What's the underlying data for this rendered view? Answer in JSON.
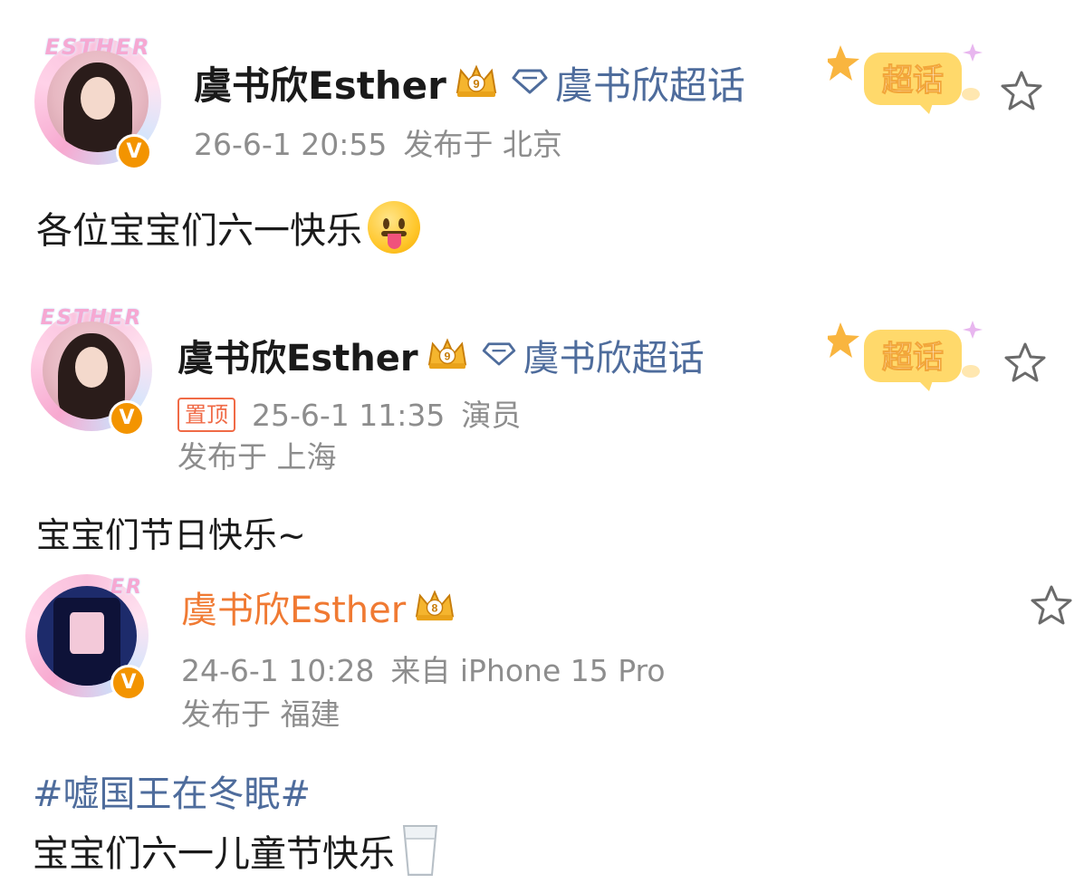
{
  "posts": [
    {
      "author": "虞书欣Esther",
      "crown_level": "9",
      "supertopic": "虞书欣超话",
      "chaohua_badge": "超话",
      "timestamp": "26-6-1 20:55",
      "location_label": "发布于 北京",
      "text": "各位宝宝们六一快乐",
      "emoji": "tongue-out-emoji",
      "avatar_ring_text": "ESTHER"
    },
    {
      "author": "虞书欣Esther",
      "crown_level": "9",
      "supertopic": "虞书欣超话",
      "chaohua_badge": "超话",
      "pinned_label": "置顶",
      "timestamp": "25-6-1 11:35",
      "role": "演员",
      "location_label": "发布于 上海",
      "text": "宝宝们节日快乐~",
      "avatar_ring_text": "ESTHER"
    },
    {
      "author": "虞书欣Esther",
      "crown_level": "8",
      "timestamp": "24-6-1 10:28",
      "source": "来自 iPhone 15 Pro",
      "location_label": "发布于 福建",
      "hashtag": "#嘘国王在冬眠#",
      "text": "宝宝们六一儿童节快乐",
      "emoji": "milk-glass-emoji",
      "avatar_ring_text": "ER"
    }
  ],
  "verified_badge": "V",
  "colors": {
    "username": "#1a1a1a",
    "username_orange": "#f07a33",
    "link_blue": "#4e6c9c",
    "meta_gray": "#8d8d8d",
    "pin_red": "#f06a46",
    "verified_orange": "#f39400"
  }
}
